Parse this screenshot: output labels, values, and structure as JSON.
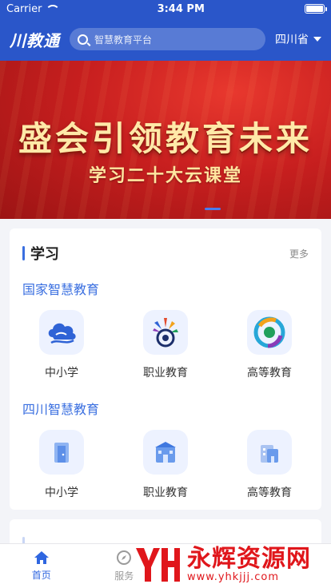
{
  "status_bar": {
    "carrier": "Carrier",
    "time": "3:44 PM"
  },
  "nav": {
    "logo": "川教通",
    "search_placeholder": "智慧教育平台",
    "region": "四川省"
  },
  "banner": {
    "title": "盛会引领教育未来",
    "subtitle": "学习二十大云课堂"
  },
  "study": {
    "title": "学习",
    "more": "更多",
    "national": {
      "title": "国家智慧教育",
      "items": [
        {
          "label": "中小学",
          "icon": "cloud-icon"
        },
        {
          "label": "职业教育",
          "icon": "vocational-logo-icon"
        },
        {
          "label": "高等教育",
          "icon": "higher-ed-logo-icon"
        }
      ]
    },
    "sichuan": {
      "title": "四川智慧教育",
      "items": [
        {
          "label": "中小学",
          "icon": "door-icon"
        },
        {
          "label": "职业教育",
          "icon": "building-icon"
        },
        {
          "label": "高等教育",
          "icon": "building-icon"
        }
      ]
    }
  },
  "tabbar": {
    "tabs": [
      {
        "label": "首页",
        "icon": "home-icon",
        "active": true
      },
      {
        "label": "服务",
        "icon": "compass-icon",
        "active": false
      }
    ]
  },
  "watermark": {
    "brand": "永辉资源网",
    "url": "www.yhkjjj.com"
  },
  "colors": {
    "primary": "#2a56c9",
    "accent": "#3a6fe0",
    "banner_red": "#c81f1f",
    "watermark_red": "#e0161b"
  }
}
